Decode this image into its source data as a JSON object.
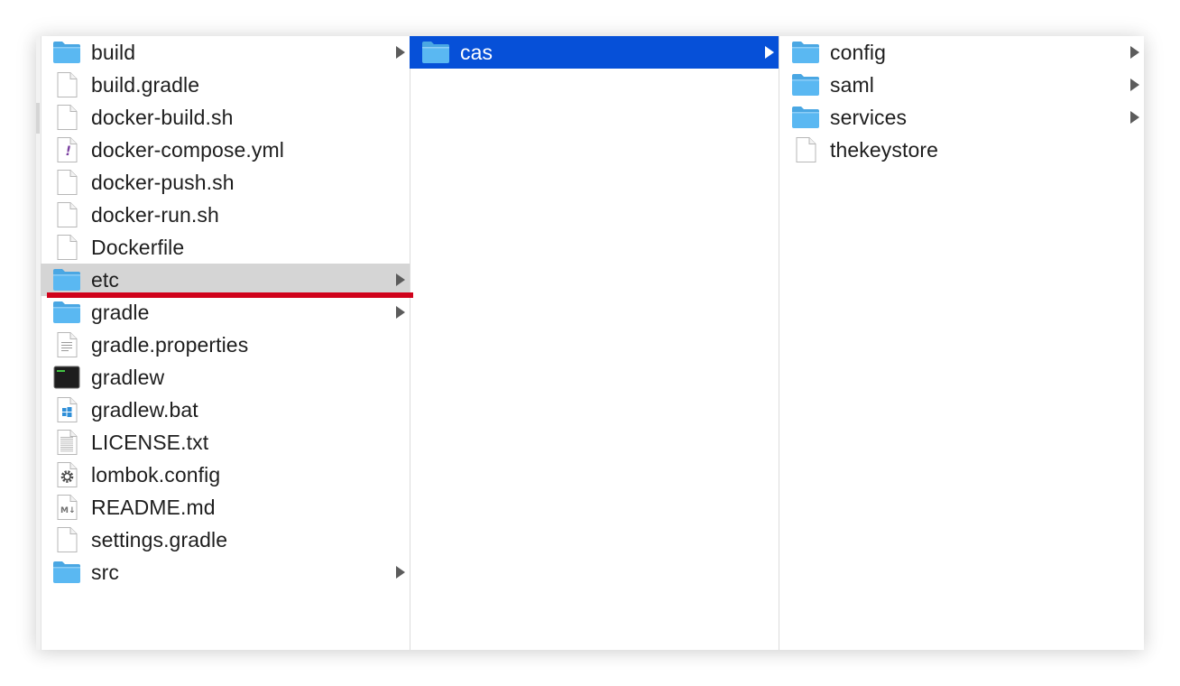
{
  "columns": [
    {
      "items": [
        {
          "name": "build",
          "kind": "folder",
          "icon": "folder-icon"
        },
        {
          "name": "build.gradle",
          "kind": "file",
          "icon": "document-icon"
        },
        {
          "name": "docker-build.sh",
          "kind": "file",
          "icon": "document-icon"
        },
        {
          "name": "docker-compose.yml",
          "kind": "file",
          "icon": "yaml-file-icon"
        },
        {
          "name": "docker-push.sh",
          "kind": "file",
          "icon": "document-icon"
        },
        {
          "name": "docker-run.sh",
          "kind": "file",
          "icon": "document-icon"
        },
        {
          "name": "Dockerfile",
          "kind": "file",
          "icon": "document-icon"
        },
        {
          "name": "etc",
          "kind": "folder",
          "icon": "folder-icon",
          "selected": "inactive"
        },
        {
          "name": "gradle",
          "kind": "folder",
          "icon": "folder-icon"
        },
        {
          "name": "gradle.properties",
          "kind": "file",
          "icon": "text-file-icon"
        },
        {
          "name": "gradlew",
          "kind": "file",
          "icon": "terminal-executable-icon"
        },
        {
          "name": "gradlew.bat",
          "kind": "file",
          "icon": "windows-batch-file-icon"
        },
        {
          "name": "LICENSE.txt",
          "kind": "file",
          "icon": "text-document-icon"
        },
        {
          "name": "lombok.config",
          "kind": "file",
          "icon": "config-gear-file-icon"
        },
        {
          "name": "README.md",
          "kind": "file",
          "icon": "markdown-file-icon"
        },
        {
          "name": "settings.gradle",
          "kind": "file",
          "icon": "document-icon"
        },
        {
          "name": "src",
          "kind": "folder",
          "icon": "folder-icon"
        }
      ]
    },
    {
      "items": [
        {
          "name": "cas",
          "kind": "folder",
          "icon": "folder-icon",
          "selected": "active"
        }
      ]
    },
    {
      "items": [
        {
          "name": "config",
          "kind": "folder",
          "icon": "folder-icon"
        },
        {
          "name": "saml",
          "kind": "folder",
          "icon": "folder-icon"
        },
        {
          "name": "services",
          "kind": "folder",
          "icon": "folder-icon"
        },
        {
          "name": "thekeystore",
          "kind": "file",
          "icon": "document-icon"
        }
      ]
    }
  ],
  "colors": {
    "folder": "#5ab8f2",
    "active_selection": "#0650d8",
    "inactive_selection": "#d5d5d5",
    "annotation_underline": "#d0021b"
  }
}
